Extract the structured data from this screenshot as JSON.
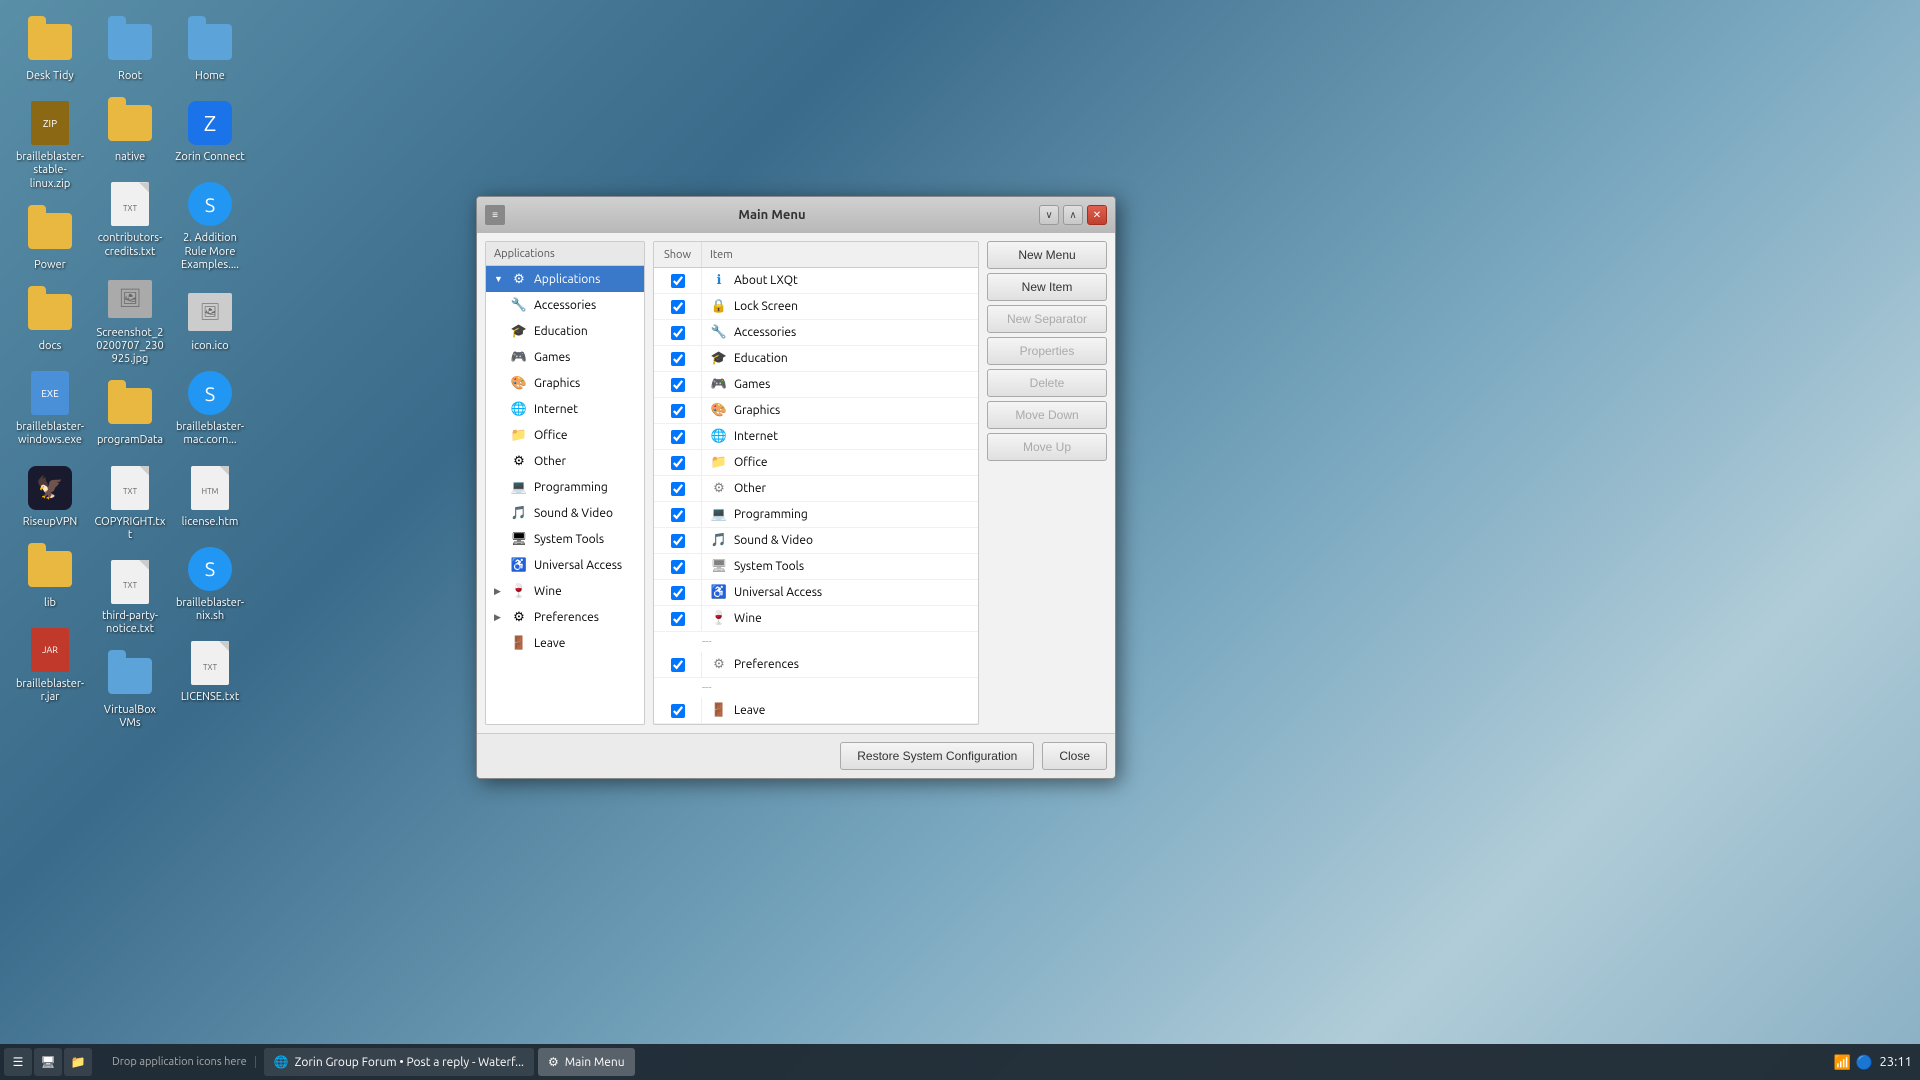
{
  "desktop": {
    "background": "sky-clouds"
  },
  "desktop_icons": [
    {
      "id": "desk-tidy",
      "label": "Desk Tidy",
      "type": "folder",
      "color": "orange"
    },
    {
      "id": "brailleblaster-stable-zip",
      "label": "brailleblaster-stable-linux.zip",
      "type": "zip"
    },
    {
      "id": "power",
      "label": "Power",
      "type": "folder",
      "color": "orange"
    },
    {
      "id": "docs",
      "label": "docs",
      "type": "folder",
      "color": "orange"
    },
    {
      "id": "brailleblaster-windows",
      "label": "brailleblaster-windows.exe",
      "type": "exe"
    },
    {
      "id": "riseupvpn",
      "label": "RiseupVPN",
      "type": "app"
    },
    {
      "id": "lib",
      "label": "lib",
      "type": "folder",
      "color": "orange"
    },
    {
      "id": "brailleblaster-jar",
      "label": "brailleblaster-r.jar",
      "type": "jar"
    },
    {
      "id": "root",
      "label": "Root",
      "type": "folder",
      "color": "blue"
    },
    {
      "id": "native",
      "label": "native",
      "type": "folder",
      "color": "orange"
    },
    {
      "id": "contributors",
      "label": "contributors-credits.txt",
      "type": "txt"
    },
    {
      "id": "screenshot",
      "label": "Screenshot_20200707_230925.jpg",
      "type": "img"
    },
    {
      "id": "programdata",
      "label": "programData",
      "type": "folder",
      "color": "orange"
    },
    {
      "id": "copyright",
      "label": "COPYRIGHT.txt",
      "type": "txt"
    },
    {
      "id": "third-party",
      "label": "third-party-notice.txt",
      "type": "txt"
    },
    {
      "id": "virtualboxvms",
      "label": "VirtualBox VMs",
      "type": "folder",
      "color": "blue"
    },
    {
      "id": "home",
      "label": "Home",
      "type": "folder",
      "color": "blue"
    },
    {
      "id": "zorin-connect",
      "label": "Zorin Connect",
      "type": "app",
      "color": "blue"
    },
    {
      "id": "2-addition",
      "label": "2. Addition Rule More Examples....",
      "type": "txt"
    },
    {
      "id": "icon-ico",
      "label": "icon.ico",
      "type": "img"
    },
    {
      "id": "brailleblaster-mac",
      "label": "brailleblaster-mac.corn...",
      "type": "app"
    },
    {
      "id": "license-htm",
      "label": "license.htm",
      "type": "txt"
    },
    {
      "id": "brailleblaster-nix",
      "label": "brailleblaster-nix.sh",
      "type": "sh"
    },
    {
      "id": "license-txt",
      "label": "LICENSE.txt",
      "type": "txt"
    }
  ],
  "taskbar": {
    "drop_label": "Drop application icons here",
    "browser_item": "Zorin Group Forum • Post a reply - Waterf...",
    "active_item": "Main Menu",
    "time": "23:11"
  },
  "dialog": {
    "title": "Main Menu",
    "sidebar_header": "Applications",
    "sidebar_items": [
      {
        "id": "applications",
        "label": "Applications",
        "selected": true,
        "arrow": false,
        "icon": "⚙"
      },
      {
        "id": "accessories",
        "label": "Accessories",
        "selected": false,
        "arrow": false,
        "icon": "🔧"
      },
      {
        "id": "education",
        "label": "Education",
        "selected": false,
        "arrow": false,
        "icon": "🎓"
      },
      {
        "id": "games",
        "label": "Games",
        "selected": false,
        "arrow": false,
        "icon": "🎮"
      },
      {
        "id": "graphics",
        "label": "Graphics",
        "selected": false,
        "arrow": false,
        "icon": "🎨"
      },
      {
        "id": "internet",
        "label": "Internet",
        "selected": false,
        "arrow": false,
        "icon": "🌐"
      },
      {
        "id": "office",
        "label": "Office",
        "selected": false,
        "arrow": false,
        "icon": "📁"
      },
      {
        "id": "other",
        "label": "Other",
        "selected": false,
        "arrow": false,
        "icon": "⚙"
      },
      {
        "id": "programming",
        "label": "Programming",
        "selected": false,
        "arrow": false,
        "icon": "💻"
      },
      {
        "id": "sound-video",
        "label": "Sound & Video",
        "selected": false,
        "arrow": false,
        "icon": "🎵"
      },
      {
        "id": "system-tools",
        "label": "System Tools",
        "selected": false,
        "arrow": false,
        "icon": "🖥"
      },
      {
        "id": "universal-access",
        "label": "Universal Access",
        "selected": false,
        "arrow": false,
        "icon": "♿"
      },
      {
        "id": "wine",
        "label": "Wine",
        "selected": false,
        "arrow": true,
        "icon": "🍷"
      },
      {
        "id": "preferences",
        "label": "Preferences",
        "selected": false,
        "arrow": true,
        "icon": "⚙"
      },
      {
        "id": "leave",
        "label": "Leave",
        "selected": false,
        "arrow": false,
        "icon": "🚪"
      }
    ],
    "col_show": "Show",
    "col_item": "Item",
    "content_rows": [
      {
        "label": "About LXQt",
        "checked": true,
        "icon": "ℹ",
        "icon_color": "blue",
        "type": "item"
      },
      {
        "label": "Lock Screen",
        "checked": true,
        "icon": "🔒",
        "icon_color": "gray",
        "type": "item"
      },
      {
        "label": "Accessories",
        "checked": true,
        "icon": "🔧",
        "icon_color": "orange",
        "type": "item"
      },
      {
        "label": "Education",
        "checked": true,
        "icon": "🎓",
        "icon_color": "green",
        "type": "item"
      },
      {
        "label": "Games",
        "checked": true,
        "icon": "🎮",
        "icon_color": "green",
        "type": "item"
      },
      {
        "label": "Graphics",
        "checked": true,
        "icon": "🎨",
        "icon_color": "purple",
        "type": "item"
      },
      {
        "label": "Internet",
        "checked": true,
        "icon": "🌐",
        "icon_color": "blue",
        "type": "item"
      },
      {
        "label": "Office",
        "checked": true,
        "icon": "📁",
        "icon_color": "gray",
        "type": "item"
      },
      {
        "label": "Other",
        "checked": true,
        "icon": "⚙",
        "icon_color": "gray",
        "type": "item"
      },
      {
        "label": "Programming",
        "checked": true,
        "icon": "💻",
        "icon_color": "blue",
        "type": "item"
      },
      {
        "label": "Sound & Video",
        "checked": true,
        "icon": "🎵",
        "icon_color": "orange",
        "type": "item"
      },
      {
        "label": "System Tools",
        "checked": true,
        "icon": "🖥",
        "icon_color": "gray",
        "type": "item"
      },
      {
        "label": "Universal Access",
        "checked": true,
        "icon": "♿",
        "icon_color": "blue",
        "type": "item"
      },
      {
        "label": "Wine",
        "checked": true,
        "icon": "🍷",
        "icon_color": "red",
        "type": "item"
      },
      {
        "label": "---",
        "type": "separator"
      },
      {
        "label": "Preferences",
        "checked": true,
        "icon": "⚙",
        "icon_color": "gray",
        "type": "item"
      },
      {
        "label": "---",
        "type": "separator"
      },
      {
        "label": "Leave",
        "checked": true,
        "icon": "🚪",
        "icon_color": "red",
        "type": "item"
      }
    ],
    "action_buttons": {
      "new_menu": "New Menu",
      "new_item": "New Item",
      "new_separator": "New Separator",
      "properties": "Properties",
      "delete": "Delete",
      "move_down": "Move Down",
      "move_up": "Move Up"
    },
    "footer_buttons": {
      "restore": "Restore System Configuration",
      "close": "Close"
    }
  }
}
